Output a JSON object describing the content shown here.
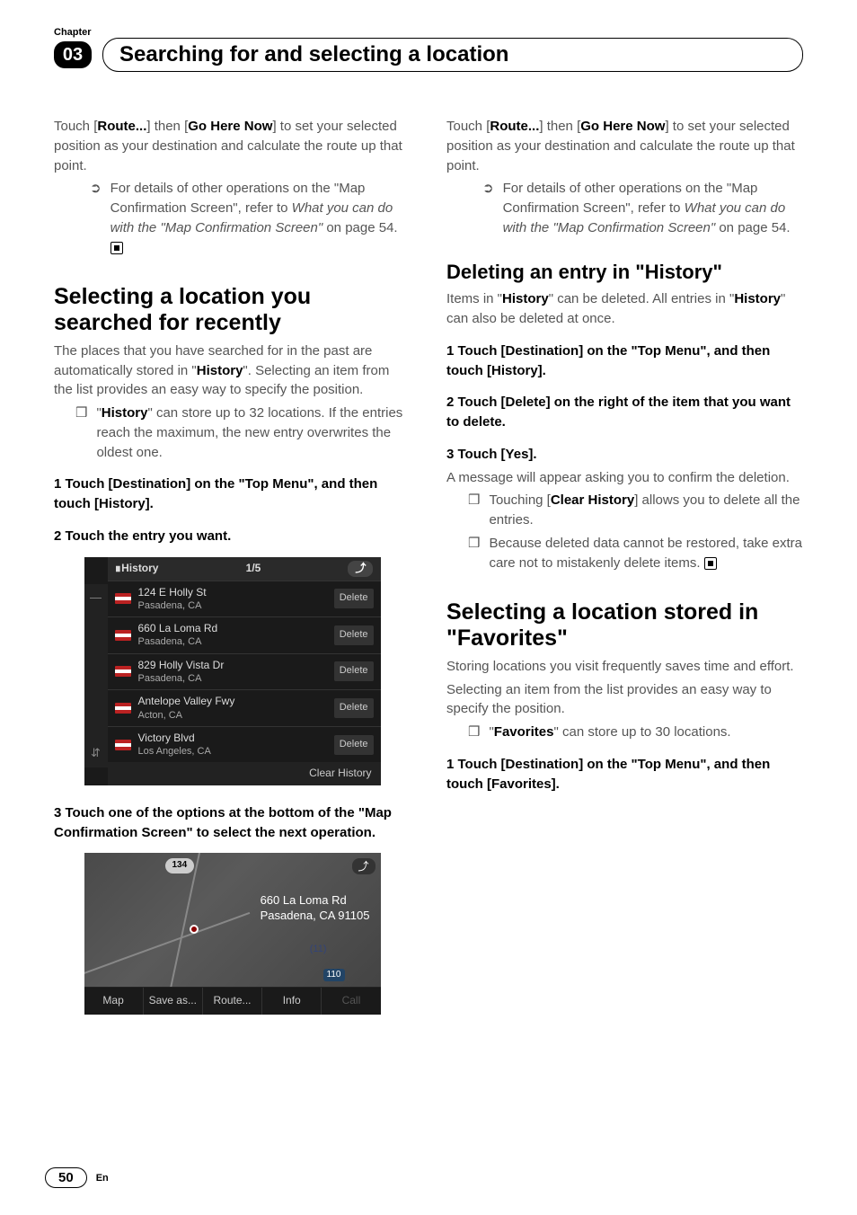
{
  "header": {
    "chapter_label": "Chapter",
    "chapter_num": "03",
    "title": "Searching for and selecting a location"
  },
  "left": {
    "intro_p1a": "Touch [",
    "intro_b1": "Route...",
    "intro_p1b": "] then [",
    "intro_b2": "Go Here Now",
    "intro_p1c": "] to set your selected position as your destination and calculate the route up that point.",
    "detail_lead": "For details of other operations on the \"Map Confirmation Screen\", refer to ",
    "detail_italic": "What you can do with the \"Map Confirmation Screen\"",
    "detail_page": " on page 54.",
    "h2": "Selecting a location you searched for recently",
    "p2a": "The places that you have searched for in the past are automatically stored in \"",
    "p2b": "History",
    "p2c": "\". Selecting an item from the list provides an easy way to specify the position.",
    "note_a": "\"",
    "note_b": "History",
    "note_c": "\" can store up to 32 locations. If the entries reach the maximum, the new entry overwrites the oldest one.",
    "step1": "1    Touch [Destination] on the \"Top Menu\", and then touch [History].",
    "step2": "2    Touch the entry you want.",
    "step3": "3    Touch one of the options at the bottom of the \"Map Confirmation Screen\" to select the next operation."
  },
  "history_ss": {
    "title": "History",
    "page": "1/5",
    "rows": [
      {
        "main": "124 E Holly St",
        "sub": "Pasadena, CA",
        "del": "Delete"
      },
      {
        "main": "660 La Loma Rd",
        "sub": "Pasadena, CA",
        "del": "Delete"
      },
      {
        "main": "829 Holly Vista Dr",
        "sub": "Pasadena, CA",
        "del": "Delete"
      },
      {
        "main": "Antelope Valley Fwy",
        "sub": "Acton, CA",
        "del": "Delete"
      },
      {
        "main": "Victory Blvd",
        "sub": "Los Angeles, CA",
        "del": "Delete"
      }
    ],
    "clear": "Clear History",
    "side_top": "—",
    "side_bot": "⇵"
  },
  "map_ss": {
    "badge": "134",
    "addr1": "660 La Loma Rd",
    "addr2": "Pasadena, CA 91105",
    "se": "(11)",
    "b110": "110",
    "tabs": [
      "Map",
      "Save as...",
      "Route...",
      "Info",
      "Call"
    ]
  },
  "right": {
    "intro_p1a": "Touch [",
    "intro_b1": "Route...",
    "intro_p1b": "] then [",
    "intro_b2": "Go Here Now",
    "intro_p1c": "] to set your selected position as your destination and calculate the route up that point.",
    "detail_lead": "For details of other operations on the \"Map Confirmation Screen\", refer to ",
    "detail_italic": "What you can do with the \"Map Confirmation Screen\"",
    "detail_page": " on page 54.",
    "del_h": "Deleting an entry in \"History\"",
    "del_p_a": "Items in \"",
    "del_p_b": "History",
    "del_p_c": "\" can be deleted. All entries in \"",
    "del_p_d": "History",
    "del_p_e": "\" can also be deleted at once.",
    "del_s1": "1    Touch [Destination] on the \"Top Menu\", and then touch [History].",
    "del_s2": "2    Touch [Delete] on the right of the item that you want to delete.",
    "del_s3": "3    Touch [Yes].",
    "del_msg": "A message will appear asking you to confirm the deletion.",
    "del_n1a": "Touching [",
    "del_n1b": "Clear History",
    "del_n1c": "] allows you to delete all the entries.",
    "del_n2": "Because deleted data cannot be restored, take extra care not to mistakenly delete items.",
    "fav_h": "Selecting a location stored in \"Favorites\"",
    "fav_p1": "Storing locations you visit frequently saves time and effort.",
    "fav_p2": "Selecting an item from the list provides an easy way to specify the position.",
    "fav_n_a": "\"",
    "fav_n_b": "Favorites",
    "fav_n_c": "\" can store up to 30 locations.",
    "fav_s1": "1    Touch [Destination] on the \"Top Menu\", and then touch [Favorites]."
  },
  "footer": {
    "page": "50",
    "lang": "En"
  }
}
